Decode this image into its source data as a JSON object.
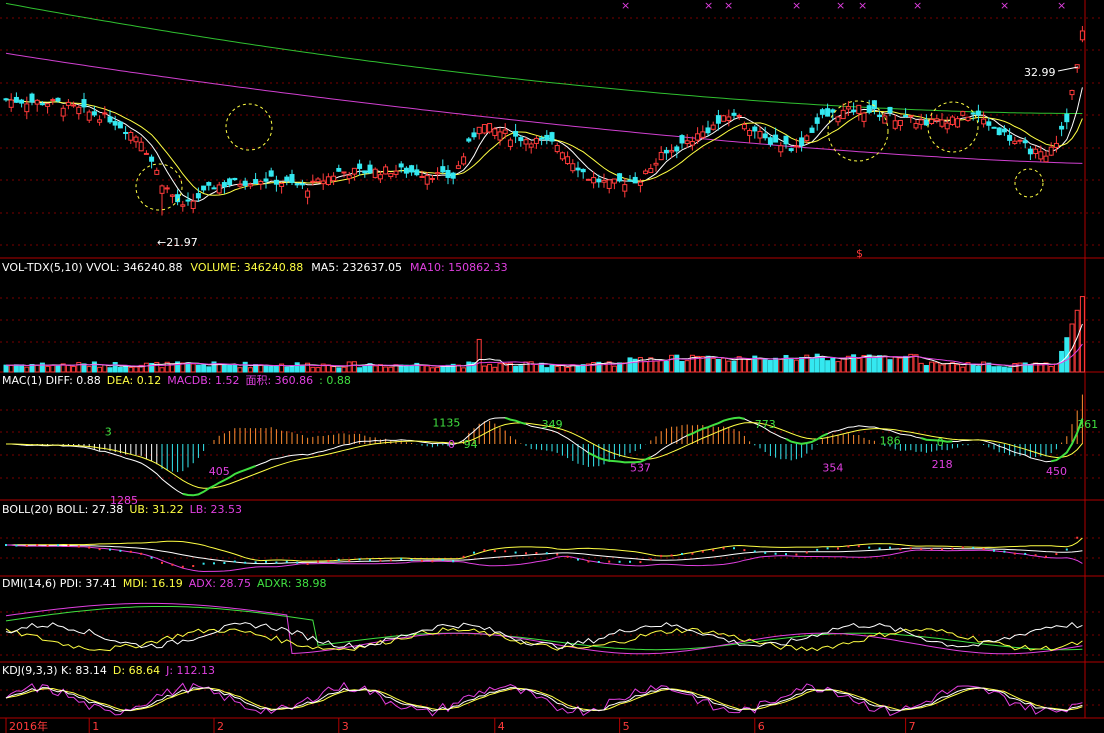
{
  "colors": {
    "up": "#ff3b3b",
    "down": "#34e8f0",
    "ma_white": "#ffffff",
    "ma_yellow": "#ffff44",
    "ma_magenta": "#d040d0",
    "ma_green": "#30c030",
    "grid": "#7a0000",
    "separator": "#b00000",
    "annot_magenta": "#e040e0",
    "annot_green": "#40e040"
  },
  "chart_data": {
    "type": "candlestick",
    "price_panel": {
      "ylim": [
        19.5,
        34.5
      ],
      "high_label": "32.99",
      "low_label": "21.97",
      "arrow_glyph": "←",
      "marker_glyph": "$",
      "top_markers": "× ×",
      "long_ma_green_endpoints": [
        34.3,
        27.9
      ],
      "long_ma_magenta_endpoints": [
        31.4,
        25.0
      ]
    },
    "volume_panel": {
      "title_parts": [
        {
          "text": "VOL-TDX(5,10) VVOL: 346240.88",
          "color": "#ffffff"
        },
        {
          "text": "VOLUME: 346240.88",
          "color": "#ffff44"
        },
        {
          "text": "MA5: 232637.05",
          "color": "#ffffff"
        },
        {
          "text": "MA10: 150862.33",
          "color": "#e040e0"
        }
      ]
    },
    "macd_panel": {
      "title_parts": [
        {
          "text": "MAC(1) DIFF: 0.88",
          "color": "#ffffff"
        },
        {
          "text": "DEA: 0.12",
          "color": "#ffff44"
        },
        {
          "text": "MACDB: 1.52",
          "color": "#e040e0"
        },
        {
          "text": "面积: 360.86",
          "color": "#e040e0"
        },
        {
          "text": ": 0.88",
          "color": "#40e040"
        }
      ],
      "annotations": [
        {
          "text": "3",
          "color": "#40e040",
          "i": 19,
          "v": 0.35
        },
        {
          "text": "1285",
          "color": "#e040e0",
          "i": 20,
          "v": -1.55
        },
        {
          "text": "405",
          "color": "#e040e0",
          "i": 39,
          "v": -0.75
        },
        {
          "text": "1135",
          "color": "#40e040",
          "i": 82,
          "v": 0.6
        },
        {
          "text": "0",
          "color": "#e040e0",
          "i": 85,
          "v": 0.0
        },
        {
          "text": "94",
          "color": "#40e040",
          "i": 88,
          "v": 0.0
        },
        {
          "text": "349",
          "color": "#40e040",
          "i": 103,
          "v": 0.55
        },
        {
          "text": "537",
          "color": "#e040e0",
          "i": 120,
          "v": -0.65
        },
        {
          "text": "773",
          "color": "#40e040",
          "i": 144,
          "v": 0.55
        },
        {
          "text": "354",
          "color": "#e040e0",
          "i": 157,
          "v": -0.65
        },
        {
          "text": "186",
          "color": "#40e040",
          "i": 168,
          "v": 0.1
        },
        {
          "text": "0",
          "color": "#40e040",
          "i": 179,
          "v": 0.05
        },
        {
          "text": "218",
          "color": "#e040e0",
          "i": 178,
          "v": -0.55
        },
        {
          "text": "450",
          "color": "#e040e0",
          "i": 200,
          "v": -0.75
        },
        {
          "text": "361",
          "color": "#40e040",
          "i": 206,
          "v": 0.55
        }
      ]
    },
    "boll_panel": {
      "title_parts": [
        {
          "text": "BOLL(20) BOLL: 27.38",
          "color": "#ffffff"
        },
        {
          "text": "UB: 31.22",
          "color": "#ffff44"
        },
        {
          "text": "LB: 23.53",
          "color": "#e040e0"
        }
      ]
    },
    "dmi_panel": {
      "title_parts": [
        {
          "text": "DMI(14,6) PDI: 37.41",
          "color": "#ffffff"
        },
        {
          "text": "MDI: 16.19",
          "color": "#ffff44"
        },
        {
          "text": "ADX: 28.75",
          "color": "#e040e0"
        },
        {
          "text": "ADXR: 38.98",
          "color": "#40e040"
        }
      ]
    },
    "kdj_panel": {
      "title_parts": [
        {
          "text": "KDJ(9,3,3) K: 83.14",
          "color": "#ffffff"
        },
        {
          "text": "D: 68.64",
          "color": "#ffff44"
        },
        {
          "text": "J: 112.13",
          "color": "#e040e0"
        }
      ]
    },
    "x_axis": {
      "labels": [
        {
          "text": "2016年",
          "i": 0
        },
        {
          "text": "1",
          "i": 16
        },
        {
          "text": "2",
          "i": 40
        },
        {
          "text": "3",
          "i": 64
        },
        {
          "text": "4",
          "i": 94
        },
        {
          "text": "5",
          "i": 118
        },
        {
          "text": "6",
          "i": 144
        },
        {
          "text": "7",
          "i": 173
        }
      ]
    }
  }
}
